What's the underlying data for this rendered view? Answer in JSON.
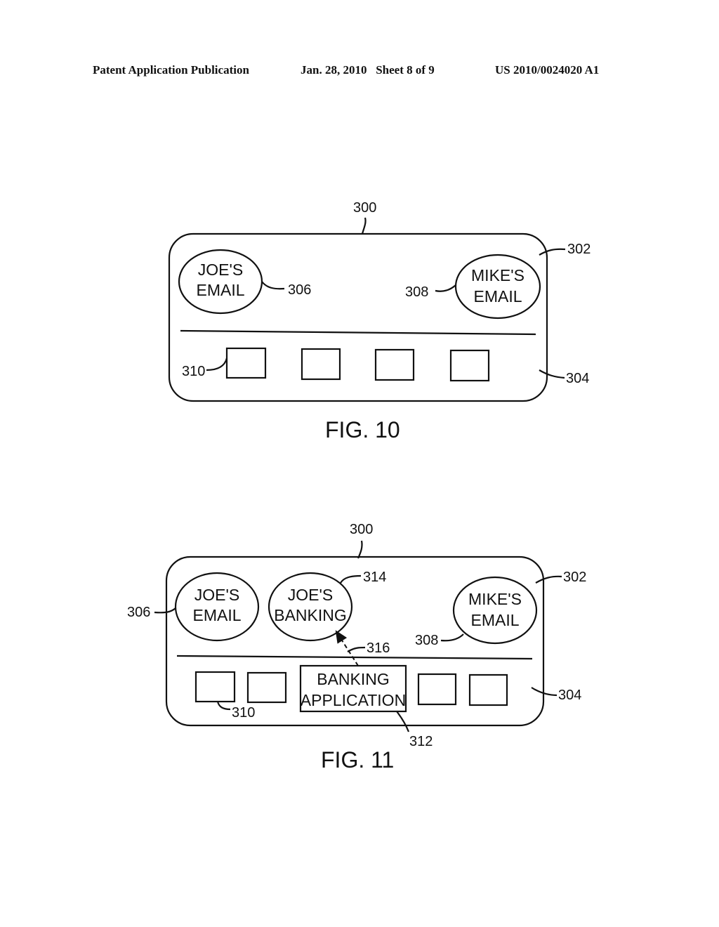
{
  "header": {
    "publication": "Patent Application Publication",
    "date_sheet": "Jan. 28, 2010   Sheet 8 of 9",
    "number": "US 2010/0024020 A1"
  },
  "fig10": {
    "caption": "FIG. 10",
    "ref_device": "300",
    "ref_upper": "302",
    "ref_lower": "304",
    "joe_email": {
      "line1": "JOE'S",
      "line2": "EMAIL",
      "ref": "306"
    },
    "mike_email": {
      "line1": "MIKE'S",
      "line2": "EMAIL",
      "ref": "308"
    },
    "ref_icons": "310"
  },
  "fig11": {
    "caption": "FIG. 11",
    "ref_device": "300",
    "ref_upper": "302",
    "ref_lower": "304",
    "joe_email": {
      "line1": "JOE'S",
      "line2": "EMAIL",
      "ref": "306"
    },
    "joe_banking": {
      "line1": "JOE'S",
      "line2": "BANKING",
      "ref": "314"
    },
    "mike_email": {
      "line1": "MIKE'S",
      "line2": "EMAIL",
      "ref": "308"
    },
    "banking_app": {
      "line1": "BANKING",
      "line2": "APPLICATION",
      "ref": "312"
    },
    "ref_icons": "310",
    "ref_arrow": "316"
  }
}
